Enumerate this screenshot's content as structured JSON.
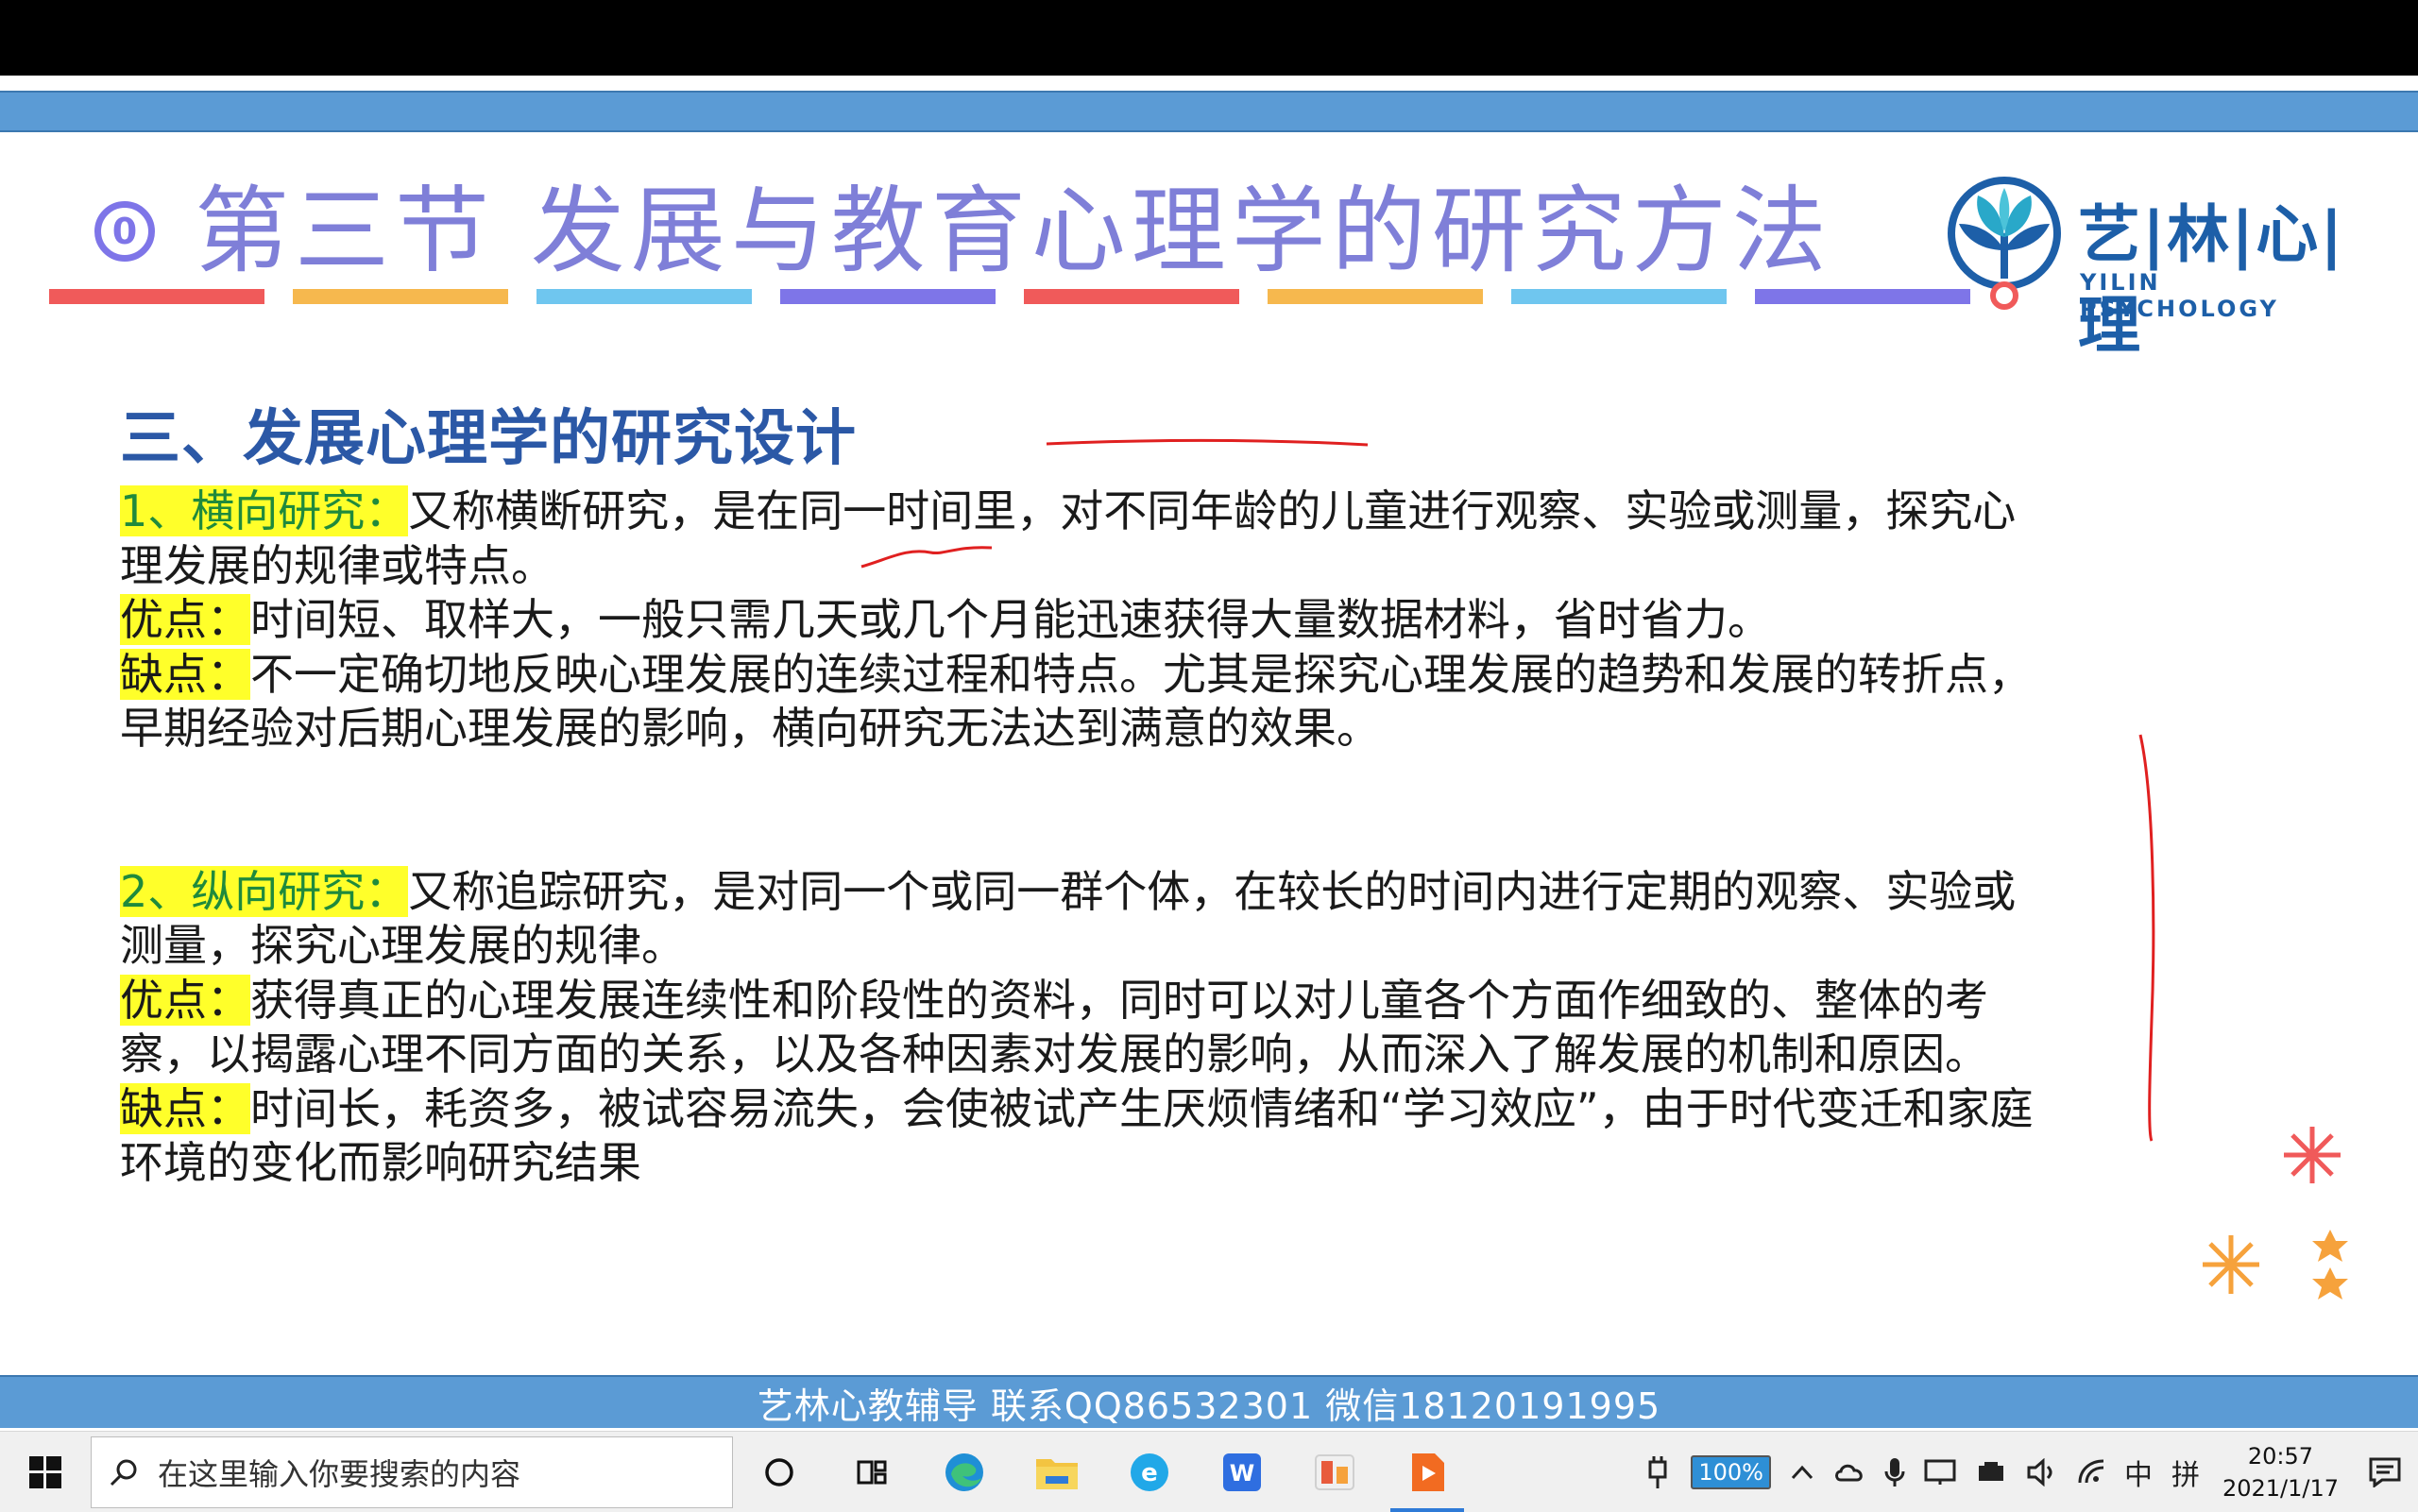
{
  "slide": {
    "title": "第三节  发展与教育心理学的研究方法",
    "title_icon_text": "0",
    "title_color": "#7f7fd8",
    "accent_bar_colors": [
      "#f05a5a",
      "#f6b84e",
      "#6fc6ef",
      "#7e75e8",
      "#f05a5a",
      "#f6b84e",
      "#6fc6ef",
      "#7e75e8"
    ],
    "logo": {
      "cn": "艺|林|心|理",
      "en": "YILIN PSYCHOLOGY",
      "color": "#1d5fa8"
    },
    "heading": "三、发展心理学的研究设计",
    "sections": [
      {
        "label": "1、横向研究：",
        "text": "又称横断研究，是在同一时间里，对不同年龄的儿童进行观察、实验或测量，探究心理发展的规律或特点。",
        "pros_label": "优点：",
        "pros": "时间短、取样大，一般只需几天或几个月能迅速获得大量数据材料，省时省力。",
        "cons_label": "缺点：",
        "cons": "不一定确切地反映心理发展的连续过程和特点。尤其是探究心理发展的趋势和发展的转折点，早期经验对后期心理发展的影响，横向研究无法达到满意的效果。"
      },
      {
        "label": "2、纵向研究：",
        "text": "又称追踪研究，是对同一个或同一群个体，在较长的时间内进行定期的观察、实验或测量，探究心理发展的规律。",
        "pros_label": "优点：",
        "pros": "获得真正的心理发展连续性和阶段性的资料，同时可以对儿童各个方面作细致的、整体的考察，以揭露心理不同方面的关系，以及各种因素对发展的影响，从而深入了解发展的机制和原因。",
        "cons_label": "缺点：",
        "cons": "时间长，耗资多，被试容易流失，会使被试产生厌烦情绪和“学习效应”，由于时代变迁和家庭环境的变化而影响研究结果"
      }
    ],
    "footer": "艺林心教辅导    联系QQ86532301 微信18120191995",
    "highlight_color": "#ffff2a",
    "heading_color": "#2b58a6",
    "band_color": "#5b9bd5"
  },
  "taskbar": {
    "search_placeholder": "在这里输入你要搜索的内容",
    "battery": "100%",
    "ime_lang": "中",
    "ime_mode": "拼",
    "time": "20:57",
    "date": "2021/1/17",
    "apps": [
      "task-view",
      "widgets",
      "edge",
      "file-explorer",
      "browser-e",
      "wps-writer",
      "wps-presentation",
      "media-player"
    ]
  }
}
